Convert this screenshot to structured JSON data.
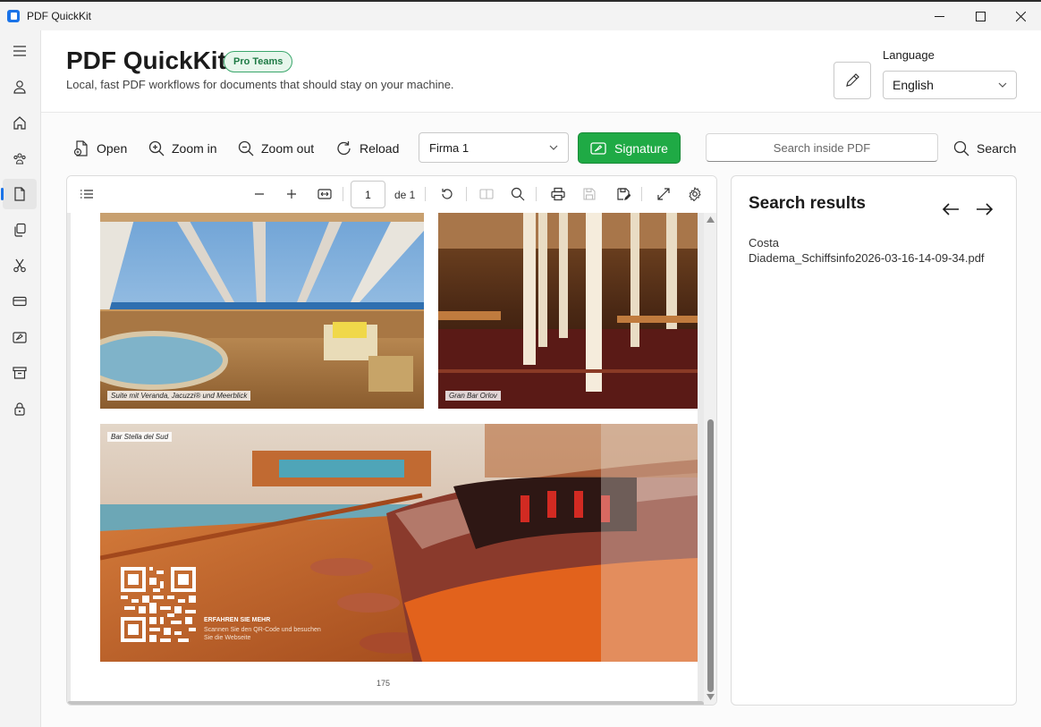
{
  "window": {
    "title": "PDF QuickKit",
    "controls": [
      "minimize-icon",
      "maximize-icon",
      "close-icon"
    ]
  },
  "sidebar": {
    "items": [
      {
        "name": "menu",
        "icon": "hamburger-menu-icon"
      },
      {
        "name": "account",
        "icon": "person-icon"
      },
      {
        "name": "home",
        "icon": "home-icon"
      },
      {
        "name": "team",
        "icon": "group-icon"
      },
      {
        "name": "document",
        "icon": "document-icon",
        "active": true
      },
      {
        "name": "copy",
        "icon": "copy-icon"
      },
      {
        "name": "cut",
        "icon": "scissors-icon"
      },
      {
        "name": "card",
        "icon": "card-icon"
      },
      {
        "name": "sign",
        "icon": "signature-icon"
      },
      {
        "name": "archive",
        "icon": "archive-icon"
      },
      {
        "name": "lock",
        "icon": "lock-icon"
      }
    ]
  },
  "header": {
    "title": "PDF QuickKit",
    "badge": "Pro Teams",
    "subtitle": "Local, fast PDF workflows for documents that should stay on your machine.",
    "language_label": "Language",
    "language_value": "English"
  },
  "toolbar": {
    "open_label": "Open",
    "zoom_in_label": "Zoom in",
    "zoom_out_label": "Zoom out",
    "reload_label": "Reload",
    "signature_select_value": "Firma 1",
    "signature_label": "Signature",
    "search_placeholder": "Search inside PDF",
    "search_label": "Search"
  },
  "viewer": {
    "page_value": "1",
    "page_of": "de 1",
    "page_number": "175",
    "captions": {
      "photo1": "Suite mit Veranda, Jacuzzi® und Meerblick",
      "photo2": "Gran Bar Orlov",
      "photo3": "Bar Stella del Sud"
    },
    "promo_title": "ERFAHREN SIE MEHR",
    "promo_text": "Scannen Sie den QR-Code und besuchen Sie die Webseite"
  },
  "results": {
    "title": "Search results",
    "items": [
      {
        "line1": "Costa",
        "line2": "Diadema_Schiffsinfo2026-03-16-14-09-34.pdf"
      }
    ]
  },
  "colors": {
    "accent": "#1a73e8",
    "signature_green": "#1faa45",
    "badge_green": "#1e7a45"
  }
}
